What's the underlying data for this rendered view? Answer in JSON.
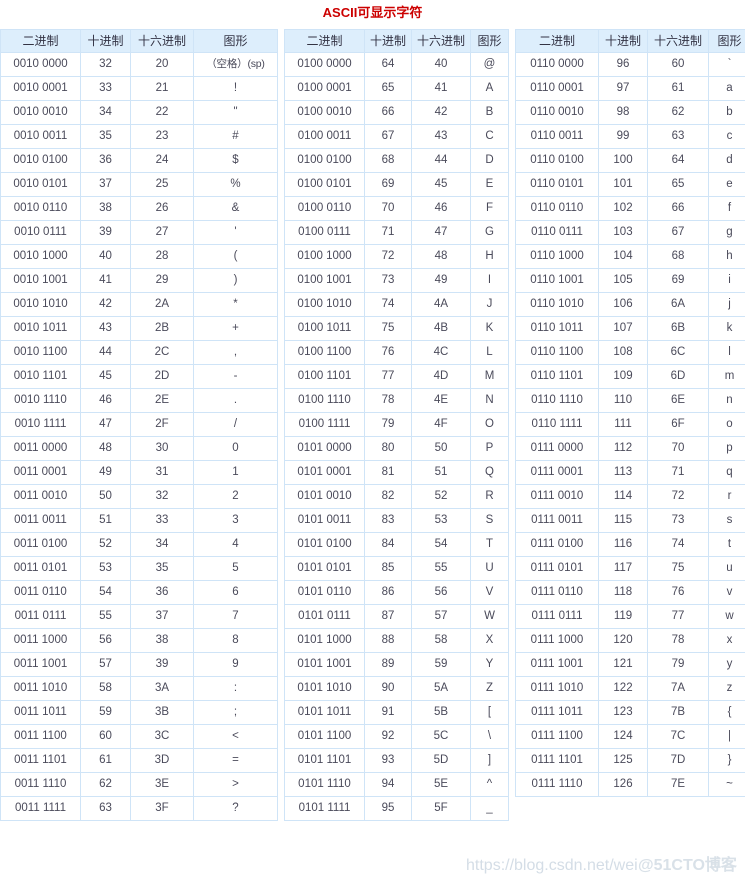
{
  "title": "ASCII可显示字符",
  "columns": [
    "二进制",
    "十进制",
    "十六进制",
    "图形"
  ],
  "watermark": {
    "url": "https://blog.csdn.net/wei",
    "brand": "@51CTO博客"
  },
  "tables": [
    {
      "id": "table-1",
      "headers": [
        "二进制",
        "十进制",
        "十六进制",
        "图形"
      ],
      "rows": [
        [
          "0010 0000",
          "32",
          "20",
          "（空格）(sp)"
        ],
        [
          "0010 0001",
          "33",
          "21",
          "!"
        ],
        [
          "0010 0010",
          "34",
          "22",
          "\""
        ],
        [
          "0010 0011",
          "35",
          "23",
          "#"
        ],
        [
          "0010 0100",
          "36",
          "24",
          "$"
        ],
        [
          "0010 0101",
          "37",
          "25",
          "%"
        ],
        [
          "0010 0110",
          "38",
          "26",
          "&"
        ],
        [
          "0010 0111",
          "39",
          "27",
          "'"
        ],
        [
          "0010 1000",
          "40",
          "28",
          "("
        ],
        [
          "0010 1001",
          "41",
          "29",
          ")"
        ],
        [
          "0010 1010",
          "42",
          "2A",
          "*"
        ],
        [
          "0010 1011",
          "43",
          "2B",
          "+"
        ],
        [
          "0010 1100",
          "44",
          "2C",
          ","
        ],
        [
          "0010 1101",
          "45",
          "2D",
          "-"
        ],
        [
          "0010 1110",
          "46",
          "2E",
          "."
        ],
        [
          "0010 1111",
          "47",
          "2F",
          "/"
        ],
        [
          "0011 0000",
          "48",
          "30",
          "0"
        ],
        [
          "0011 0001",
          "49",
          "31",
          "1"
        ],
        [
          "0011 0010",
          "50",
          "32",
          "2"
        ],
        [
          "0011 0011",
          "51",
          "33",
          "3"
        ],
        [
          "0011 0100",
          "52",
          "34",
          "4"
        ],
        [
          "0011 0101",
          "53",
          "35",
          "5"
        ],
        [
          "0011 0110",
          "54",
          "36",
          "6"
        ],
        [
          "0011 0111",
          "55",
          "37",
          "7"
        ],
        [
          "0011 1000",
          "56",
          "38",
          "8"
        ],
        [
          "0011 1001",
          "57",
          "39",
          "9"
        ],
        [
          "0011 1010",
          "58",
          "3A",
          ":"
        ],
        [
          "0011 1011",
          "59",
          "3B",
          ";"
        ],
        [
          "0011 1100",
          "60",
          "3C",
          "<"
        ],
        [
          "0011 1101",
          "61",
          "3D",
          "="
        ],
        [
          "0011 1110",
          "62",
          "3E",
          ">"
        ],
        [
          "0011 1111",
          "63",
          "3F",
          "?"
        ]
      ]
    },
    {
      "id": "table-2",
      "headers": [
        "二进制",
        "十进制",
        "十六进制",
        "图形"
      ],
      "rows": [
        [
          "0100 0000",
          "64",
          "40",
          "@"
        ],
        [
          "0100 0001",
          "65",
          "41",
          "A"
        ],
        [
          "0100 0010",
          "66",
          "42",
          "B"
        ],
        [
          "0100 0011",
          "67",
          "43",
          "C"
        ],
        [
          "0100 0100",
          "68",
          "44",
          "D"
        ],
        [
          "0100 0101",
          "69",
          "45",
          "E"
        ],
        [
          "0100 0110",
          "70",
          "46",
          "F"
        ],
        [
          "0100 0111",
          "71",
          "47",
          "G"
        ],
        [
          "0100 1000",
          "72",
          "48",
          "H"
        ],
        [
          "0100 1001",
          "73",
          "49",
          "I"
        ],
        [
          "0100 1010",
          "74",
          "4A",
          "J"
        ],
        [
          "0100 1011",
          "75",
          "4B",
          "K"
        ],
        [
          "0100 1100",
          "76",
          "4C",
          "L"
        ],
        [
          "0100 1101",
          "77",
          "4D",
          "M"
        ],
        [
          "0100 1110",
          "78",
          "4E",
          "N"
        ],
        [
          "0100 1111",
          "79",
          "4F",
          "O"
        ],
        [
          "0101 0000",
          "80",
          "50",
          "P"
        ],
        [
          "0101 0001",
          "81",
          "51",
          "Q"
        ],
        [
          "0101 0010",
          "82",
          "52",
          "R"
        ],
        [
          "0101 0011",
          "83",
          "53",
          "S"
        ],
        [
          "0101 0100",
          "84",
          "54",
          "T"
        ],
        [
          "0101 0101",
          "85",
          "55",
          "U"
        ],
        [
          "0101 0110",
          "86",
          "56",
          "V"
        ],
        [
          "0101 0111",
          "87",
          "57",
          "W"
        ],
        [
          "0101 1000",
          "88",
          "58",
          "X"
        ],
        [
          "0101 1001",
          "89",
          "59",
          "Y"
        ],
        [
          "0101 1010",
          "90",
          "5A",
          "Z"
        ],
        [
          "0101 1011",
          "91",
          "5B",
          "["
        ],
        [
          "0101 1100",
          "92",
          "5C",
          "\\"
        ],
        [
          "0101 1101",
          "93",
          "5D",
          "]"
        ],
        [
          "0101 1110",
          "94",
          "5E",
          "^"
        ],
        [
          "0101 1111",
          "95",
          "5F",
          "_"
        ]
      ]
    },
    {
      "id": "table-3",
      "headers": [
        "二进制",
        "十进制",
        "十六进制",
        "图形"
      ],
      "rows": [
        [
          "0110 0000",
          "96",
          "60",
          "`"
        ],
        [
          "0110 0001",
          "97",
          "61",
          "a"
        ],
        [
          "0110 0010",
          "98",
          "62",
          "b"
        ],
        [
          "0110 0011",
          "99",
          "63",
          "c"
        ],
        [
          "0110 0100",
          "100",
          "64",
          "d"
        ],
        [
          "0110 0101",
          "101",
          "65",
          "e"
        ],
        [
          "0110 0110",
          "102",
          "66",
          "f"
        ],
        [
          "0110 0111",
          "103",
          "67",
          "g"
        ],
        [
          "0110 1000",
          "104",
          "68",
          "h"
        ],
        [
          "0110 1001",
          "105",
          "69",
          "i"
        ],
        [
          "0110 1010",
          "106",
          "6A",
          "j"
        ],
        [
          "0110 1011",
          "107",
          "6B",
          "k"
        ],
        [
          "0110 1100",
          "108",
          "6C",
          "l"
        ],
        [
          "0110 1101",
          "109",
          "6D",
          "m"
        ],
        [
          "0110 1110",
          "110",
          "6E",
          "n"
        ],
        [
          "0110 1111",
          "111",
          "6F",
          "o"
        ],
        [
          "0111 0000",
          "112",
          "70",
          "p"
        ],
        [
          "0111 0001",
          "113",
          "71",
          "q"
        ],
        [
          "0111 0010",
          "114",
          "72",
          "r"
        ],
        [
          "0111 0011",
          "115",
          "73",
          "s"
        ],
        [
          "0111 0100",
          "116",
          "74",
          "t"
        ],
        [
          "0111 0101",
          "117",
          "75",
          "u"
        ],
        [
          "0111 0110",
          "118",
          "76",
          "v"
        ],
        [
          "0111 0111",
          "119",
          "77",
          "w"
        ],
        [
          "0111 1000",
          "120",
          "78",
          "x"
        ],
        [
          "0111 1001",
          "121",
          "79",
          "y"
        ],
        [
          "0111 1010",
          "122",
          "7A",
          "z"
        ],
        [
          "0111 1011",
          "123",
          "7B",
          "{"
        ],
        [
          "0111 1100",
          "124",
          "7C",
          "|"
        ],
        [
          "0111 1101",
          "125",
          "7D",
          "}"
        ],
        [
          "0111 1110",
          "126",
          "7E",
          "~"
        ]
      ]
    }
  ]
}
